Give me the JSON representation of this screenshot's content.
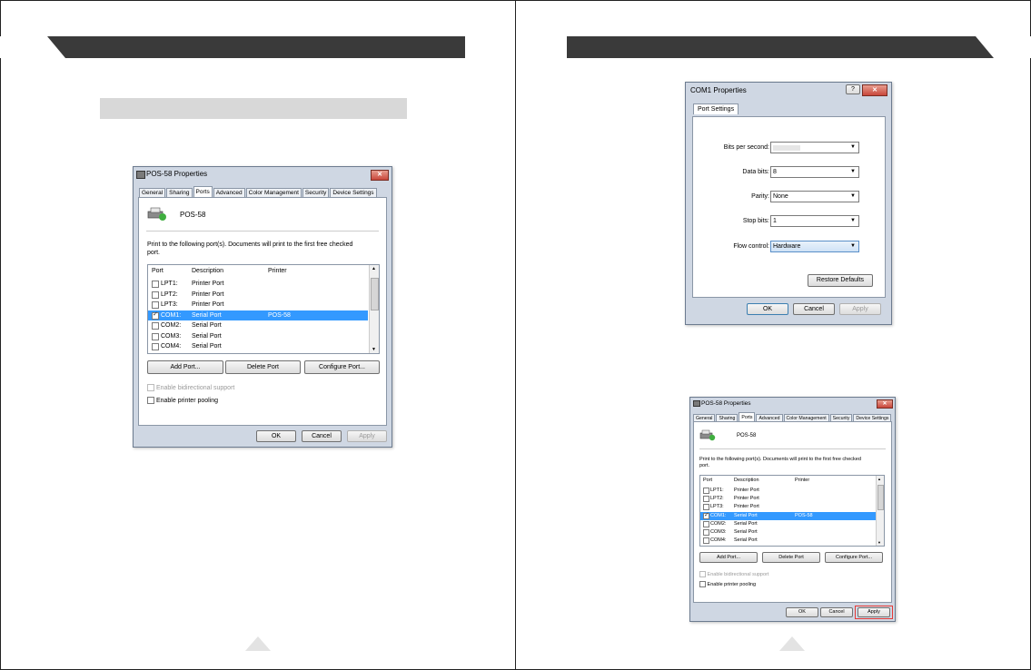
{
  "left_page": {
    "dialog": {
      "title": "POS-58 Properties",
      "close_glyph": "✕",
      "tabs": [
        "General",
        "Sharing",
        "Ports",
        "Advanced",
        "Color Management",
        "Security",
        "Device Settings"
      ],
      "printer_name": "POS-58",
      "instruction": "Print to the following port(s). Documents will print to the first free checked port.",
      "columns": [
        "Port",
        "Description",
        "Printer"
      ],
      "rows": [
        {
          "port": "LPT1:",
          "description": "Printer Port",
          "printer": ""
        },
        {
          "port": "LPT2:",
          "description": "Printer Port",
          "printer": ""
        },
        {
          "port": "LPT3:",
          "description": "Printer Port",
          "printer": ""
        },
        {
          "port": "COM1:",
          "description": "Serial Port",
          "printer": "POS-58"
        },
        {
          "port": "COM2:",
          "description": "Serial Port",
          "printer": ""
        },
        {
          "port": "COM3:",
          "description": "Serial Port",
          "printer": ""
        },
        {
          "port": "COM4:",
          "description": "Serial Port",
          "printer": ""
        }
      ],
      "add_port": "Add Port...",
      "delete_port": "Delete Port",
      "configure_port": "Configure Port...",
      "bidirectional": "Enable bidirectional support",
      "pooling": "Enable printer pooling",
      "ok": "OK",
      "cancel": "Cancel",
      "apply": "Apply"
    }
  },
  "right_page": {
    "com_dialog": {
      "title": "COM1 Properties",
      "help_glyph": "?",
      "close_glyph": "✕",
      "tab": "Port Settings",
      "bits_per_second_label": "Bits per second:",
      "bits_per_second_value": "",
      "data_bits_label": "Data bits:",
      "data_bits_value": "8",
      "parity_label": "Parity:",
      "parity_value": "None",
      "stop_bits_label": "Stop bits:",
      "stop_bits_value": "1",
      "flow_control_label": "Flow control:",
      "flow_control_value": "Hardware",
      "restore_defaults": "Restore Defaults",
      "ok": "OK",
      "cancel": "Cancel",
      "apply": "Apply"
    },
    "dialog": {
      "title": "POS-58 Properties",
      "close_glyph": "✕",
      "tabs": [
        "General",
        "Sharing",
        "Ports",
        "Advanced",
        "Color Management",
        "Security",
        "Device Settings"
      ],
      "printer_name": "POS-58",
      "instruction": "Print to the following port(s). Documents will print to the first free checked port.",
      "columns": [
        "Port",
        "Description",
        "Printer"
      ],
      "rows": [
        {
          "port": "LPT1:",
          "description": "Printer Port",
          "printer": ""
        },
        {
          "port": "LPT2:",
          "description": "Printer Port",
          "printer": ""
        },
        {
          "port": "LPT3:",
          "description": "Printer Port",
          "printer": ""
        },
        {
          "port": "COM1:",
          "description": "Serial Port",
          "printer": "POS-58"
        },
        {
          "port": "COM2:",
          "description": "Serial Port",
          "printer": ""
        },
        {
          "port": "COM3:",
          "description": "Serial Port",
          "printer": ""
        },
        {
          "port": "COM4:",
          "description": "Serial Port",
          "printer": ""
        }
      ],
      "add_port": "Add Port...",
      "delete_port": "Delete Port",
      "configure_port": "Configure Port...",
      "bidirectional": "Enable bidirectional support",
      "pooling": "Enable printer pooling",
      "ok": "OK",
      "cancel": "Cancel",
      "apply": "Apply"
    }
  },
  "icons": {
    "printer": "printer-icon",
    "page_marker": "triangle-icon"
  },
  "colors": {
    "header_band": "#3a3a3a",
    "selection": "#3399ff",
    "highlight_box": "#e53935"
  }
}
